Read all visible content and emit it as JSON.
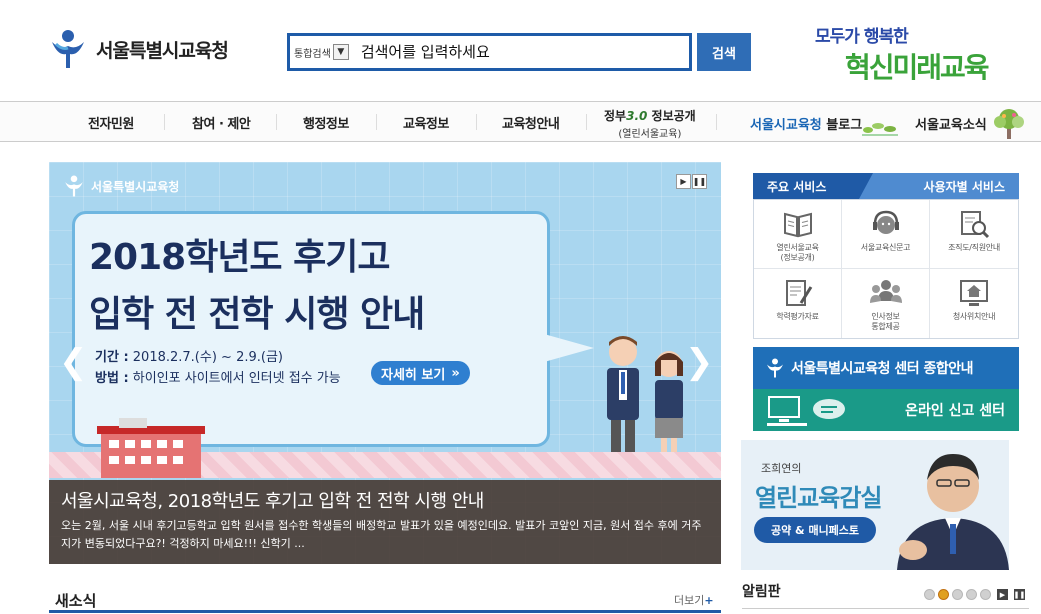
{
  "header": {
    "logo_text": "서울특별시교육청",
    "search": {
      "scope": "통합검색",
      "placeholder": "검색어를 입력하세요",
      "button": "검색"
    },
    "slogan_line1": "모두가 행복한",
    "slogan_line2": "혁신미래교육"
  },
  "nav": {
    "items": [
      "전자민원",
      "참여 · 제안",
      "행정정보",
      "교육정보",
      "교육청안내"
    ],
    "open_gov_prefix": "정부",
    "open_gov_version": "3.0",
    "open_gov_suffix": " 정보공개",
    "open_gov_sub": "(열린서울교육)",
    "blog_highlight": "서울시교육청",
    "blog_suffix": " 블로그",
    "news": "서울교육소식"
  },
  "banner": {
    "logo_text": "서울특별시교육청",
    "title_line1": "2018학년도 후기고",
    "title_line2": "입학 전 전학 시행 안내",
    "period_label": "기간 :",
    "period_value": " 2018.2.7.(수) ~ 2.9.(금)",
    "method_label": "방법 :",
    "method_value": " 하이인포 사이트에서 인터넷 접수 가능",
    "more_button": "자세히 보기",
    "caption_title": "서울시교육청, 2018학년도 후기고 입학 전 전학 시행 안내",
    "caption_body": "오는 2월, 서울 시내 후기고등학교 입학 원서를 접수한 학생들의 배정학교 발표가 있을 예정인데요.   발표가 코앞인 지금, 원서 접수 후에 거주지가 변동되었다구요?!   걱정하지 마세요!!! 신학기 ..."
  },
  "services": {
    "tab_main": "주요 서비스",
    "tab_sub": "사용자별 서비스",
    "items": [
      {
        "label": "열린서울교육",
        "sub": "(정보공개)",
        "icon": "book-icon"
      },
      {
        "label": "서울교육신문고",
        "sub": "",
        "icon": "headset-icon"
      },
      {
        "label": "조직도/직원안내",
        "sub": "",
        "icon": "magnifier-icon"
      },
      {
        "label": "학력평가자료",
        "sub": "",
        "icon": "document-pen-icon"
      },
      {
        "label": "인사정보",
        "sub": "통합제공",
        "icon": "people-icon"
      },
      {
        "label": "청사위치안내",
        "sub": "",
        "icon": "location-icon"
      }
    ]
  },
  "center_banner": {
    "top": "서울특별시교육청 센터 종합안내",
    "bottom": "온라인 신고 센터"
  },
  "ediary": {
    "line1": "조희연의",
    "line2": "열린교육감실",
    "button": "공약 & 매니페스토"
  },
  "news": {
    "title": "새소식",
    "more": "더보기"
  },
  "notice": {
    "title": "알림판"
  }
}
